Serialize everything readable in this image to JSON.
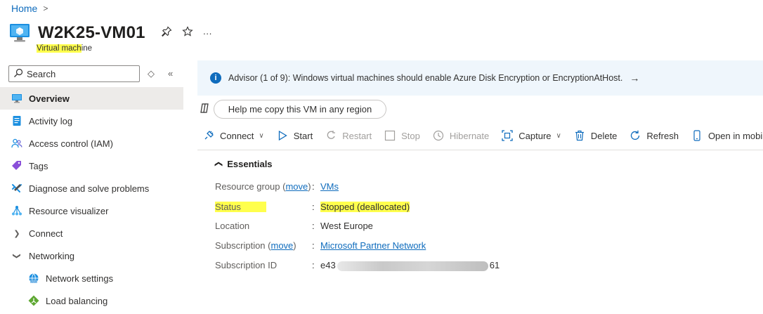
{
  "breadcrumb": {
    "home": "Home",
    "separator": ">"
  },
  "header": {
    "title": "W2K25-VM01",
    "subtitle": "Virtual machine",
    "subtitle_highlight": "Virtual mach",
    "subtitle_rest": "ine",
    "pin_icon": "pin-icon",
    "favorite_icon": "star-icon",
    "more_label": "···"
  },
  "search": {
    "placeholder": "Search"
  },
  "sidebar": {
    "items": [
      {
        "label": "Overview",
        "icon": "monitor-icon"
      },
      {
        "label": "Activity log",
        "icon": "log-icon"
      },
      {
        "label": "Access control (IAM)",
        "icon": "people-icon"
      },
      {
        "label": "Tags",
        "icon": "tag-icon"
      },
      {
        "label": "Diagnose and solve problems",
        "icon": "wrench-icon"
      },
      {
        "label": "Resource visualizer",
        "icon": "graph-icon"
      },
      {
        "label": "Connect",
        "icon": "chevron-right-icon"
      },
      {
        "label": "Networking",
        "icon": "chevron-down-icon"
      },
      {
        "label": "Network settings",
        "icon": "network-icon"
      },
      {
        "label": "Load balancing",
        "icon": "load-balancer-icon"
      }
    ]
  },
  "advisor": {
    "text": "Advisor (1 of 9): Windows virtual machines should enable Azure Disk Encryption or EncryptionAtHost.",
    "arrow": "→"
  },
  "copy_button": {
    "label": "Help me copy this VM in any region"
  },
  "toolbar": {
    "connect": "Connect",
    "start": "Start",
    "restart": "Restart",
    "stop": "Stop",
    "hibernate": "Hibernate",
    "capture": "Capture",
    "delete": "Delete",
    "refresh": "Refresh",
    "open_mobile": "Open in mobile"
  },
  "essentials": {
    "heading": "Essentials",
    "move_label": "move",
    "rows": [
      {
        "label": "Resource group",
        "value": "VMs"
      },
      {
        "label": "Status",
        "value": "Stopped (deallocated)"
      },
      {
        "label": "Location",
        "value": "West Europe"
      },
      {
        "label": "Subscription",
        "value": "Microsoft Partner Network"
      },
      {
        "label": "Subscription ID",
        "value_start": "e43",
        "value_end": "61"
      }
    ]
  },
  "colors": {
    "accent": "#0f6cbd",
    "highlight": "#ffff4d",
    "advisor_bg": "#eff6fc"
  }
}
